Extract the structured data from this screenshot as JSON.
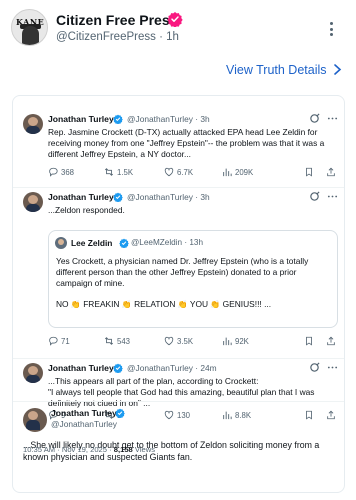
{
  "header": {
    "author_name": "Citizen Free Press",
    "author_handle": "@CitizenFreePress",
    "separator": "·",
    "post_age": "1h",
    "avatar_text": "KANE"
  },
  "details_link": "View Truth Details",
  "colors": {
    "accent": "#1d62c9",
    "verified": "#1d9bf0",
    "verified_main": "#f91880",
    "muted": "#536471"
  },
  "tweets": [
    {
      "name": "Jonathan Turley",
      "handle": "@JonathanTurley",
      "age": "· 3h",
      "text": "Rep. Jasmine Crockett (D-TX) actually attacked EPA head Lee Zeldin for receiving money from one \"Jeffrey Epstein\"-- the problem was that it was a different Jeffrey Epstein, a NY doctor...",
      "replies": "368",
      "retweets": "1.5K",
      "likes": "6.7K",
      "views": "209K"
    },
    {
      "name": "Jonathan Turley",
      "handle": "@JonathanTurley",
      "age": "· 3h",
      "text": "...Zeldon responded.",
      "replies": "71",
      "retweets": "543",
      "likes": "3.5K",
      "views": "92K"
    },
    {
      "name": "Jonathan Turley",
      "handle": "@JonathanTurley",
      "age": "· 24m",
      "text_line1": "...This appears all part of the plan, according to Crockett:",
      "text_line2": "\"I always tell people that God had this amazing, beautiful plan that I was definitely not clued in on\" ...",
      "replies": "9",
      "retweets": "9",
      "likes": "130",
      "views": "8.8K"
    },
    {
      "name": "Jonathan Turley",
      "handle": "@JonathanTurley",
      "text": "...She will likely no doubt get to the bottom of Zeldon soliciting money from a known physician and suspected Giants fan.",
      "timestamp": "10:35 AM · Nov 19, 2025 ·",
      "views_count": "8,158",
      "views_label": "Views"
    }
  ],
  "quote": {
    "name": "Lee Zeldin",
    "handle": "@LeeMZeldin",
    "age": "· 13h",
    "text": "Yes Crockett, a physician named Dr. Jeffrey Epstein (who is a totally different person than the other Jeffrey Epstein) donated to a prior campaign of mine.",
    "words": [
      "NO",
      "FREAKIN",
      "RELATION",
      "YOU",
      "GENIUS!!!",
      "..."
    ],
    "clap_emoji": "👏"
  }
}
